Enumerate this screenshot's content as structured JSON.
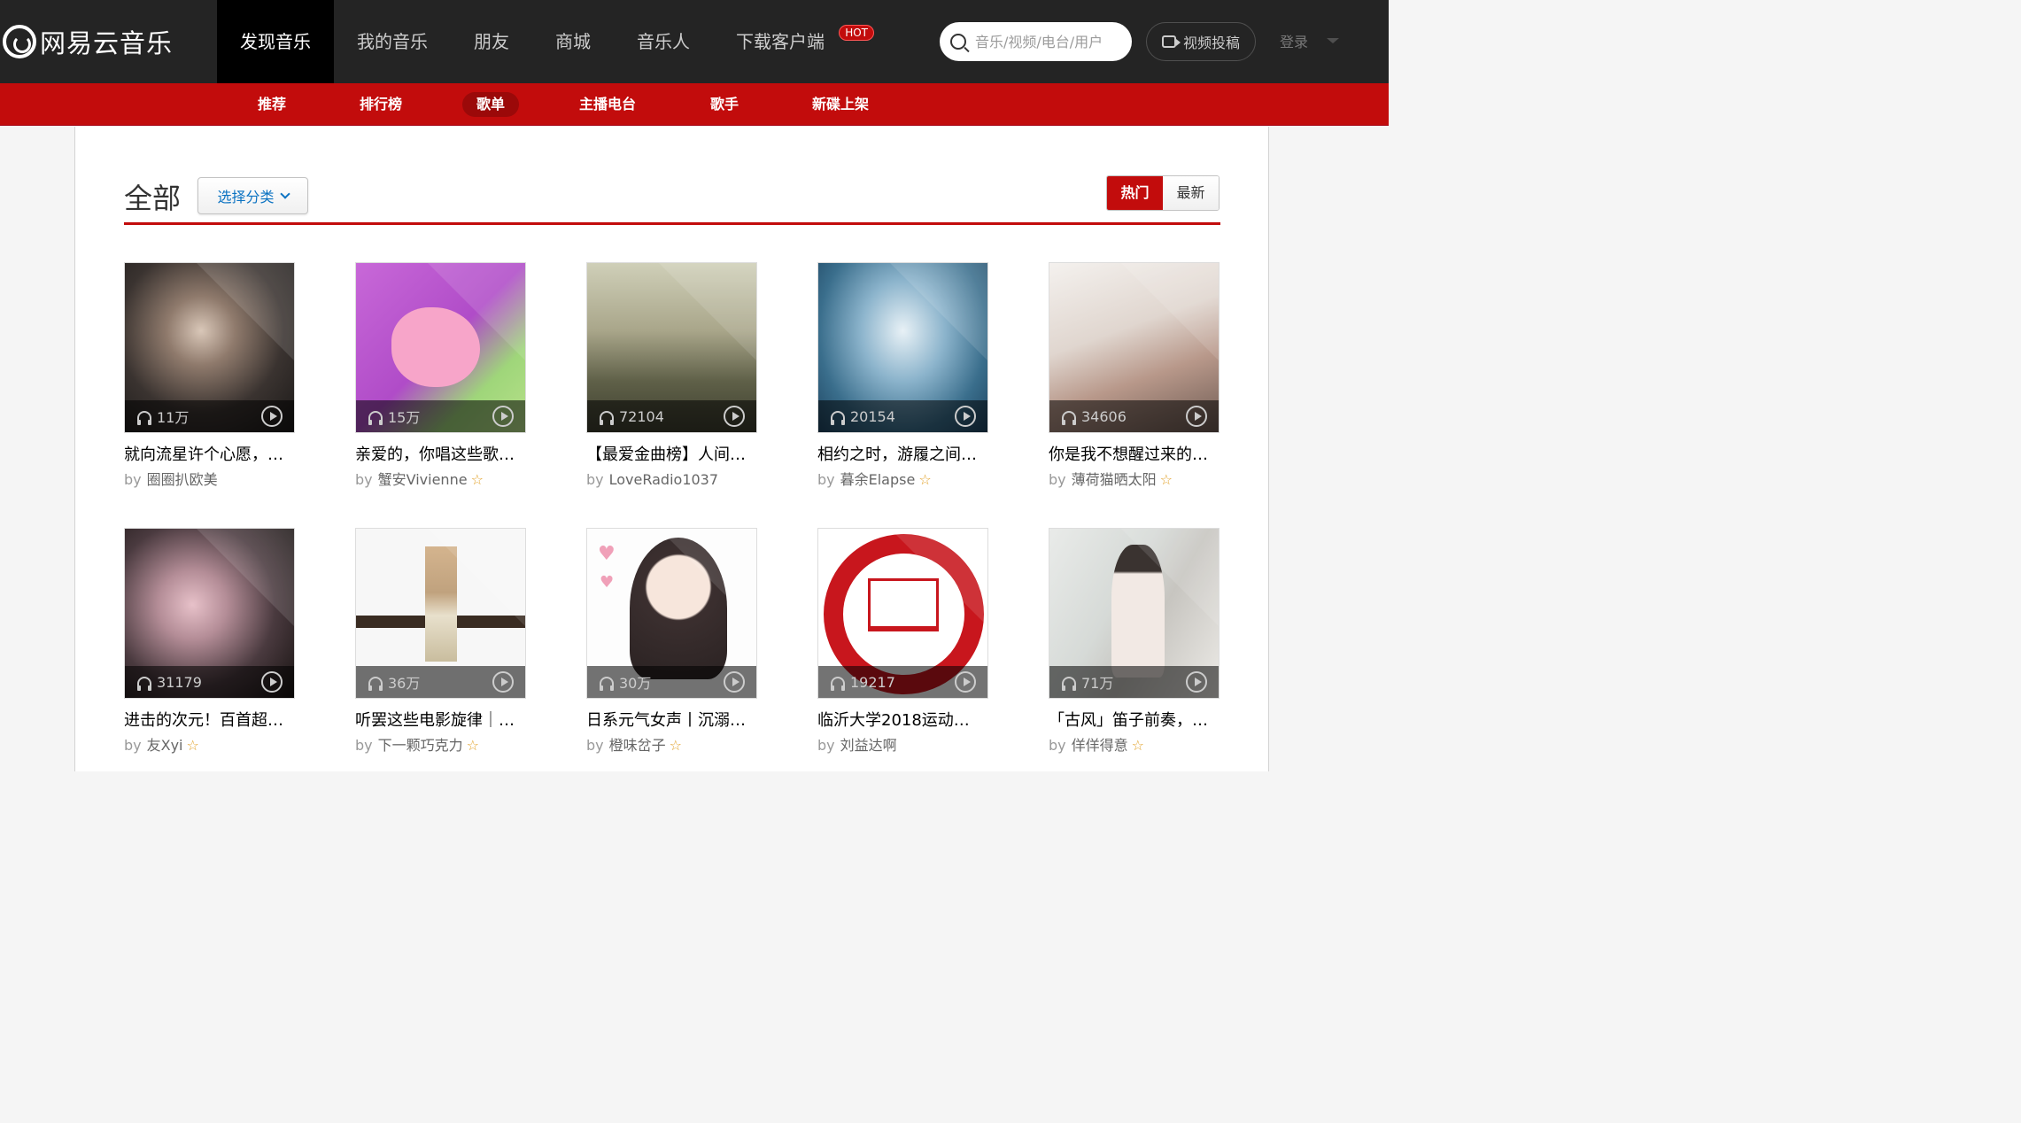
{
  "logo": {
    "text": "网易云音乐"
  },
  "nav": {
    "items": [
      {
        "label": "发现音乐",
        "active": true
      },
      {
        "label": "我的音乐",
        "active": false
      },
      {
        "label": "朋友",
        "active": false
      },
      {
        "label": "商城",
        "active": false
      },
      {
        "label": "音乐人",
        "active": false
      },
      {
        "label": "下载客户端",
        "active": false
      }
    ],
    "hot_badge": "HOT"
  },
  "search": {
    "placeholder": "音乐/视频/电台/用户"
  },
  "upload": {
    "label": "视频投稿"
  },
  "login": {
    "label": "登录"
  },
  "subnav": {
    "items": [
      {
        "label": "推荐",
        "active": false
      },
      {
        "label": "排行榜",
        "active": false
      },
      {
        "label": "歌单",
        "active": true
      },
      {
        "label": "主播电台",
        "active": false
      },
      {
        "label": "歌手",
        "active": false
      },
      {
        "label": "新碟上架",
        "active": false
      }
    ]
  },
  "page": {
    "title": "全部",
    "category_button": "选择分类",
    "sort": {
      "hot": "热门",
      "new": "最新",
      "active": "hot"
    }
  },
  "playlists": [
    {
      "title": "就向流星许个心愿，在你最孤独时守护着你",
      "display_title": "就向流星许个心愿，…",
      "by": "by",
      "author": "圈圈扒欧美",
      "plays": "11万",
      "star": false
    },
    {
      "title": "亲爱的，你唱这些歌…",
      "display_title": "亲爱的，你唱这些歌…",
      "by": "by",
      "author": "蟹安Vivienne",
      "plays": "15万",
      "star": true
    },
    {
      "title": "【最爱金曲榜】人间…",
      "display_title": "【最爱金曲榜】人间…",
      "by": "by",
      "author": "LoveRadio1037",
      "plays": "72104",
      "star": false
    },
    {
      "title": "相约之时，游履之间…",
      "display_title": "相约之时，游履之间…",
      "by": "by",
      "author": "暮余Elapse",
      "plays": "20154",
      "star": true
    },
    {
      "title": "你是我不想醒过来的…",
      "display_title": "你是我不想醒过来的…",
      "by": "by",
      "author": "薄荷猫晒太阳",
      "plays": "34606",
      "star": true
    },
    {
      "title": "进击的次元！百首超…",
      "display_title": "进击的次元！百首超…",
      "by": "by",
      "author": "友Xyi",
      "plays": "31179",
      "star": true
    },
    {
      "title": "听罢这些电影旋律｜…",
      "display_title": "听罢这些电影旋律｜…",
      "by": "by",
      "author": "下一颗巧克力",
      "plays": "36万",
      "star": true
    },
    {
      "title": "日系元气女声丨沉溺…",
      "display_title": "日系元气女声丨沉溺…",
      "by": "by",
      "author": "橙味岔子",
      "plays": "30万",
      "star": true
    },
    {
      "title": "临沂大学2018运动…",
      "display_title": "临沂大学2018运动…",
      "by": "by",
      "author": "刘益达啊",
      "plays": "19217",
      "star": false
    },
    {
      "title": "「古风」笛子前奏，…",
      "display_title": "「古风」笛子前奏，…",
      "by": "by",
      "author": "佯佯得意",
      "plays": "71万",
      "star": true
    }
  ],
  "colors": {
    "brand_red": "#c20c0c",
    "topbar": "#242424",
    "star": "#e2a229"
  }
}
